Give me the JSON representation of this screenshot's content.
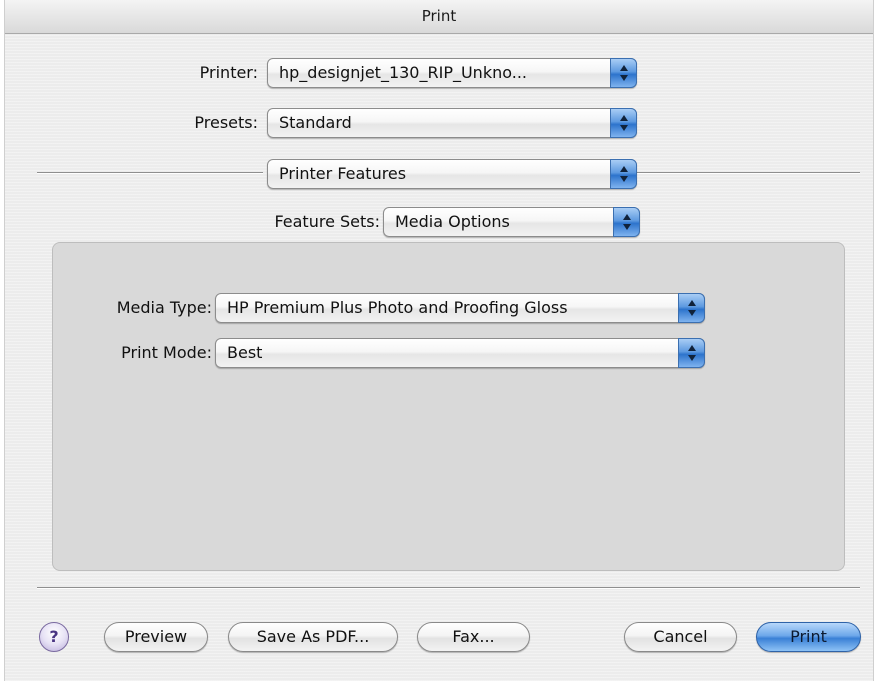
{
  "window": {
    "title": "Print"
  },
  "printer": {
    "label": "Printer:",
    "value": "hp_designjet_130_RIP_Unkno..."
  },
  "presets": {
    "label": "Presets:",
    "value": "Standard"
  },
  "pane": {
    "value": "Printer Features"
  },
  "feature_sets": {
    "label": "Feature Sets:",
    "value": "Media Options"
  },
  "media_type": {
    "label": "Media Type:",
    "value": "HP Premium Plus Photo and Proofing Gloss"
  },
  "print_mode": {
    "label": "Print Mode:",
    "value": "Best"
  },
  "buttons": {
    "help": "?",
    "preview": "Preview",
    "save_pdf": "Save As PDF...",
    "fax": "Fax...",
    "cancel": "Cancel",
    "print": "Print"
  },
  "icons": {
    "popup_arrows": "up-down-arrows-icon",
    "help": "question-mark-icon"
  },
  "colors": {
    "accent_blue": "#3a80d6",
    "window_bg": "#ececec",
    "group_bg": "#d9d9d9"
  }
}
